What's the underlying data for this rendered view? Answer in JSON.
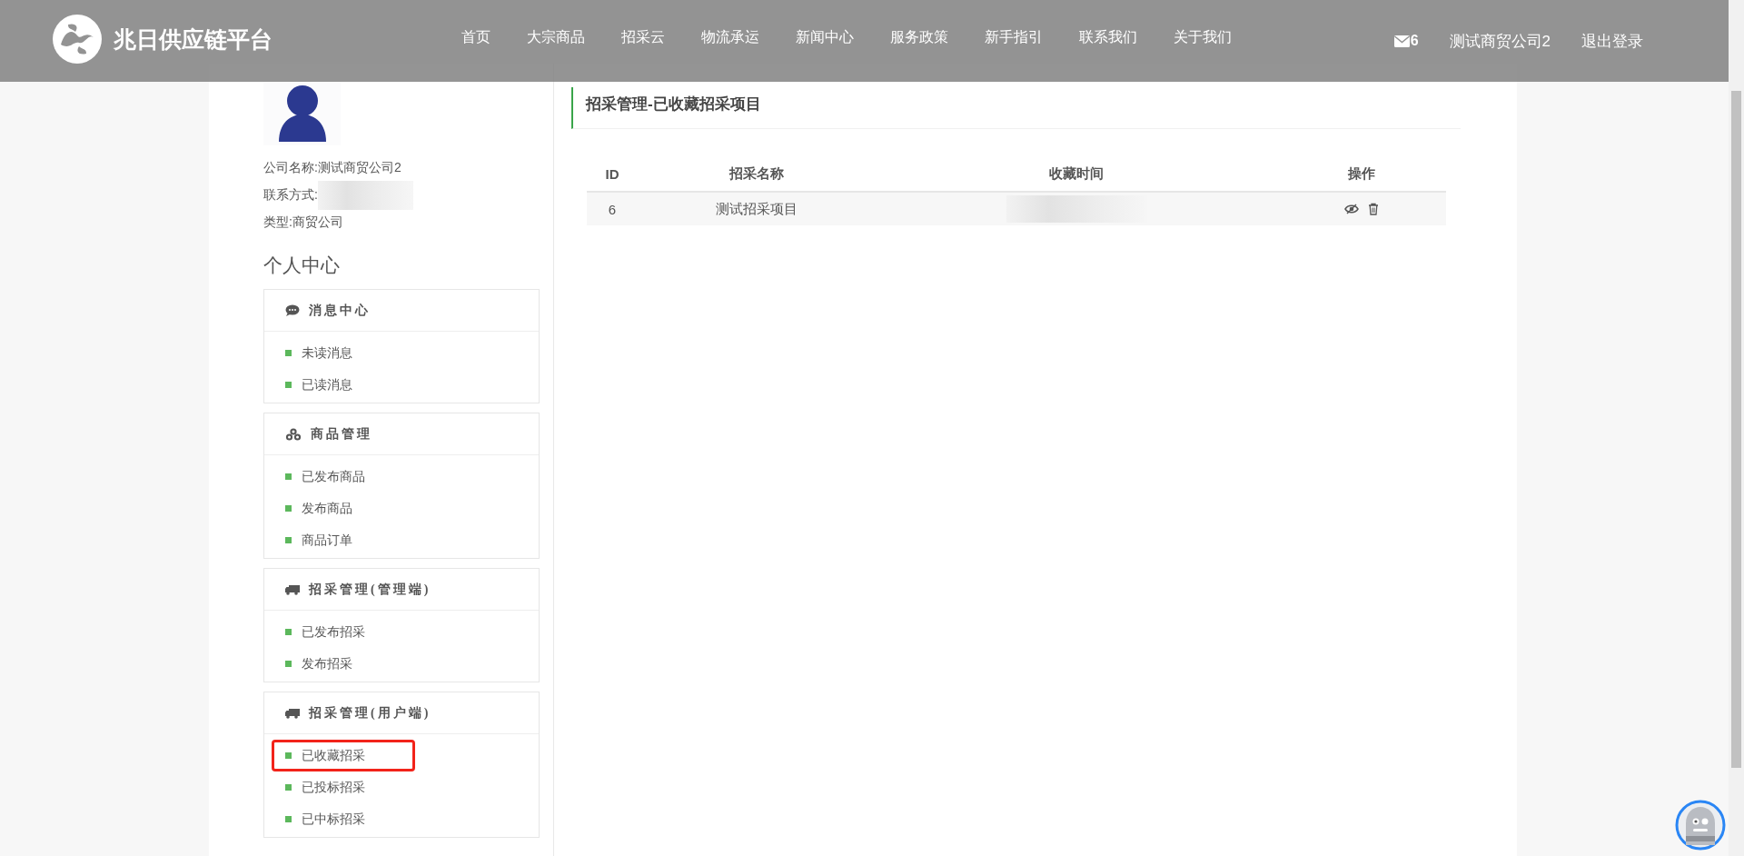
{
  "header": {
    "brand": "兆日供应链平台",
    "nav": [
      "首页",
      "大宗商品",
      "招采云",
      "物流承运",
      "新闻中心",
      "服务政策",
      "新手指引",
      "联系我们",
      "关于我们"
    ],
    "message_count": "6",
    "user": "测试商贸公司2",
    "logout": "退出登录"
  },
  "profile": {
    "company_label": "公司名称:",
    "company": "测试商贸公司2",
    "contact_label": "联系方式:",
    "type_label": "类型:",
    "type": "商贸公司"
  },
  "sidebar": {
    "title": "个人中心",
    "groups": [
      {
        "title": "消息中心",
        "kind": "chat",
        "items": [
          {
            "label": "未读消息",
            "highlighted": false
          },
          {
            "label": "已读消息",
            "highlighted": false
          }
        ]
      },
      {
        "title": "商品管理",
        "kind": "cubes",
        "items": [
          {
            "label": "已发布商品",
            "highlighted": false
          },
          {
            "label": "发布商品",
            "highlighted": false
          },
          {
            "label": "商品订单",
            "highlighted": false
          }
        ]
      },
      {
        "title": "招采管理(管理端)",
        "kind": "truck",
        "items": [
          {
            "label": "已发布招采",
            "highlighted": false
          },
          {
            "label": "发布招采",
            "highlighted": false
          }
        ]
      },
      {
        "title": "招采管理(用户端)",
        "kind": "truck",
        "items": [
          {
            "label": "已收藏招采",
            "highlighted": true
          },
          {
            "label": "已投标招采",
            "highlighted": false
          },
          {
            "label": "已中标招采",
            "highlighted": false
          }
        ]
      }
    ]
  },
  "main": {
    "title": "招采管理-已收藏招采项目",
    "table": {
      "columns": [
        "ID",
        "招采名称",
        "收藏时间",
        "操作"
      ],
      "rows": [
        {
          "id": "6",
          "name": "测试招采项目"
        }
      ]
    }
  }
}
